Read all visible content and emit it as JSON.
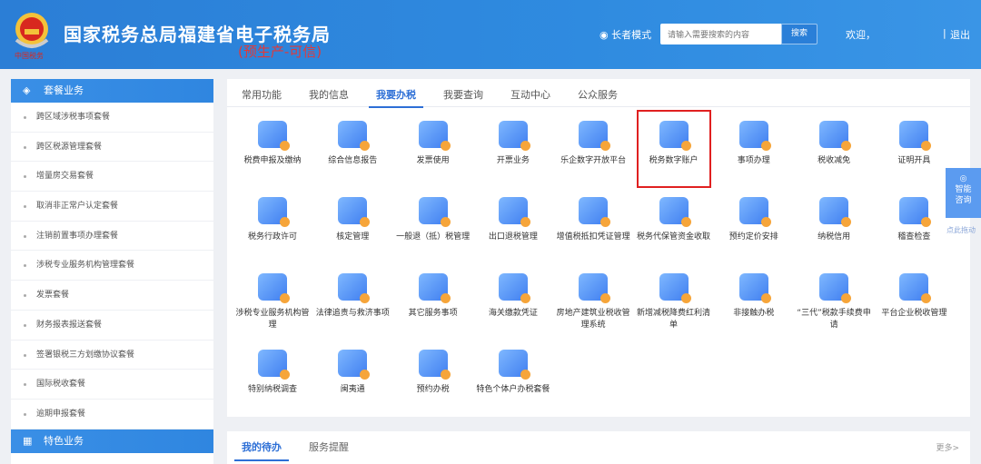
{
  "header": {
    "title": "国家税务总局福建省电子税务局",
    "subtitle": "(预生产-可信)",
    "elder_mode": "长者模式",
    "search_placeholder": "请输入需要搜索的内容",
    "search_button": "搜索",
    "welcome": "欢迎，",
    "separator": "|",
    "logout": "退出"
  },
  "sidebar": {
    "section1": "套餐业务",
    "items": [
      "跨区域涉税事项套餐",
      "跨区税源管理套餐",
      "增量房交易套餐",
      "取消非正常户认定套餐",
      "注销前置事项办理套餐",
      "涉税专业服务机构管理套餐",
      "发票套餐",
      "财务报表报送套餐",
      "签署银税三方划缴协议套餐",
      "国际税收套餐",
      "逾期申报套餐"
    ],
    "section2": "特色业务"
  },
  "tabs": [
    "常用功能",
    "我的信息",
    "我要办税",
    "我要查询",
    "互动中心",
    "公众服务"
  ],
  "active_tab": "我要办税",
  "grid": [
    "税费申报及缴纳",
    "综合信息报告",
    "发票使用",
    "开票业务",
    "乐企数字开放平台",
    "税务数字账户",
    "事项办理",
    "税收减免",
    "证明开具",
    "税务行政许可",
    "核定管理",
    "一般退（抵）税管理",
    "出口退税管理",
    "增值税抵扣凭证管理",
    "税务代保管资金收取",
    "预约定价安排",
    "纳税信用",
    "稽查检查",
    "涉税专业服务机构管理",
    "法律追责与救济事项",
    "其它服务事项",
    "海关缴款凭证",
    "房地产建筑业税收管理系统",
    "新增减税降费红利清单",
    "非接触办税",
    "“三代”税款手续费申请",
    "平台企业税收管理",
    "特别纳税调查",
    "闽夷通",
    "预约办税",
    "特色个体户办税套餐"
  ],
  "bottom": {
    "tabs": [
      "我的待办",
      "服务提醒"
    ],
    "more": "更多>"
  },
  "float": {
    "label1": "智能",
    "label2": "咨询",
    "drag": "点此拖动"
  },
  "colors": {
    "brand": "#2b7ed6",
    "accent": "#f6a53a",
    "highlight": "#e02020"
  }
}
